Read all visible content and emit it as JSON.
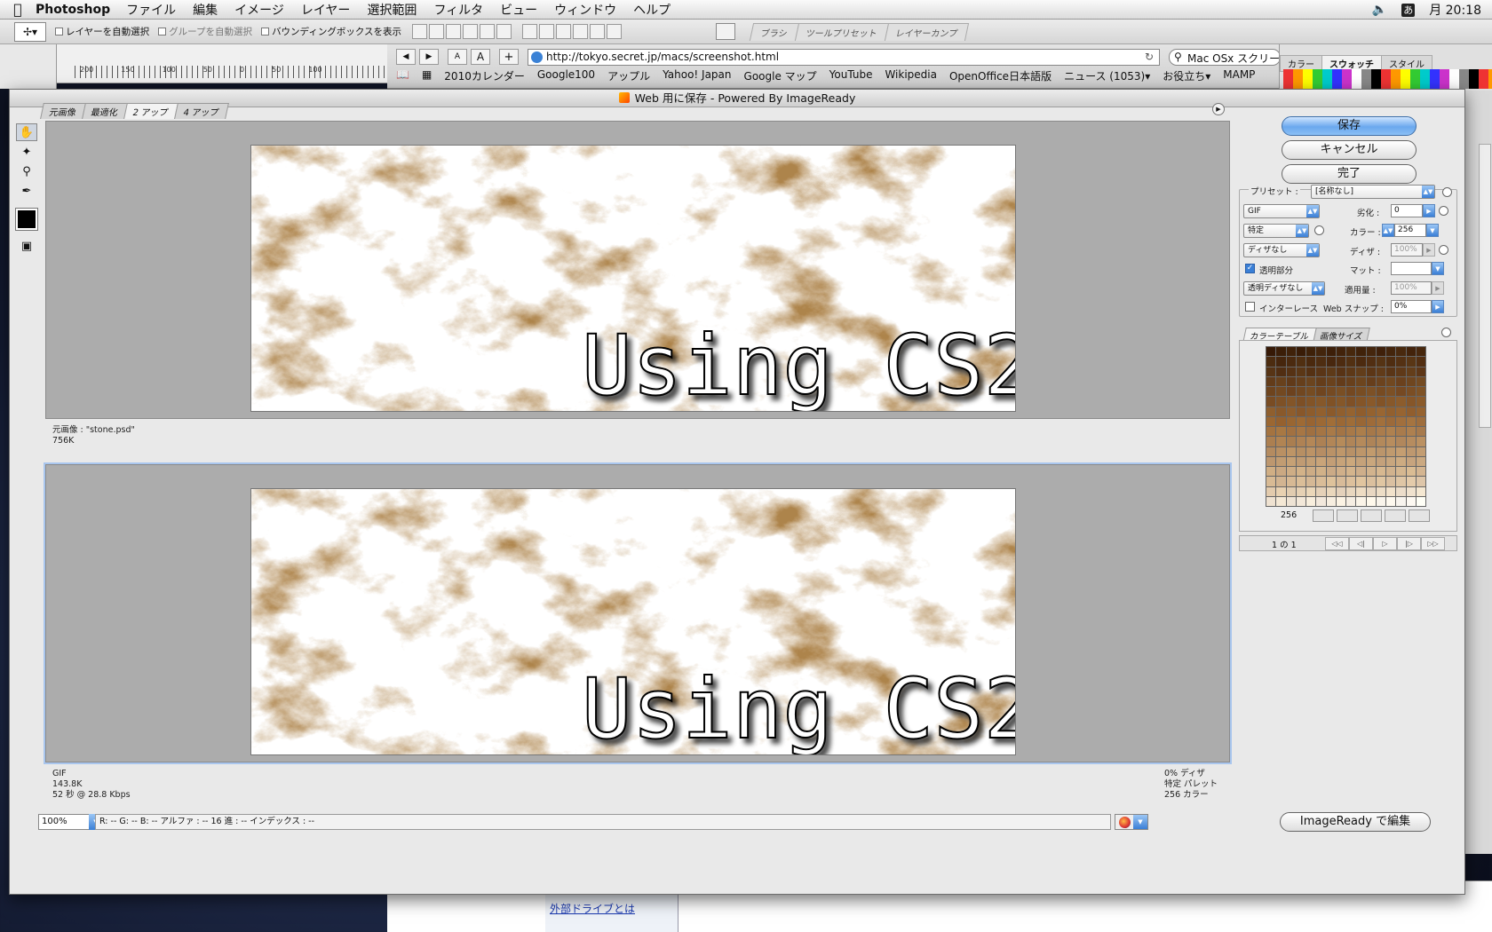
{
  "menubar": {
    "app": "Photoshop",
    "items": [
      "ファイル",
      "編集",
      "イメージ",
      "レイヤー",
      "選択範囲",
      "フィルタ",
      "ビュー",
      "ウィンドウ",
      "ヘルプ"
    ],
    "ime": "あ",
    "clock": "月 20:18"
  },
  "options": {
    "auto_select_layer": "レイヤーを自動選択",
    "auto_select_group": "グループを自動選択",
    "show_bbox": "バウンディングボックスを表示",
    "wells": [
      "ブラシ",
      "ツールプリセット",
      "レイヤーカンプ"
    ]
  },
  "ruler": {
    "labels": [
      "200",
      "150",
      "100",
      "50",
      "0",
      "50",
      "100"
    ]
  },
  "browser": {
    "url": "http://tokyo.secret.jp/macs/screenshot.html",
    "search": "Mac OSx スクリー",
    "bookmarks": [
      "2010カレンダー",
      "Google100",
      "アップル",
      "Yahoo! Japan",
      "Google マップ",
      "YouTube",
      "Wikipedia",
      "OpenOffice日本語版",
      "ニュース (1053)▾",
      "お役立ち▾",
      "MAMP"
    ]
  },
  "right_panels": {
    "tabs": [
      "カラー",
      "スウォッチ",
      "スタイル"
    ],
    "active_tab": "スウォッチ"
  },
  "dialog": {
    "title": "Web 用に保存 - Powered By ImageReady",
    "view_tabs": [
      "元画像",
      "最適化",
      "2 アップ",
      "4 アップ"
    ],
    "active_view_tab": "2 アップ",
    "image_text": "Using CS2",
    "original": {
      "name": "元画像 : \"stone.psd\"",
      "size": "756K"
    },
    "optimized": {
      "format": "GIF",
      "size": "143.8K",
      "time": "52 秒 @ 28.8 Kbps",
      "dither": "0% ディザ",
      "palette": "特定 パレット",
      "colors": "256 カラー"
    }
  },
  "buttons": {
    "save": "保存",
    "cancel": "キャンセル",
    "done": "完了",
    "edit_imageready": "ImageReady で編集"
  },
  "settings": {
    "preset_label": "プリセット :",
    "preset_value": "[名称なし]",
    "format": "GIF",
    "reduction": "特定",
    "dither_algo": "ディザなし",
    "transparency_label": "透明部分",
    "transparency_checked": true,
    "trans_dither": "透明ディザなし",
    "interlace_label": "インターレース",
    "interlace_checked": false,
    "lossy_label": "劣化 :",
    "lossy_value": "0",
    "colors_label": "カラー :",
    "colors_value": "256",
    "dither_label": "ディザ :",
    "dither_value": "100%",
    "matte_label": "マット :",
    "matte_value": "",
    "amount_label": "適用量 :",
    "amount_value": "100%",
    "websnap_label": "Web スナップ :",
    "websnap_value": "0%"
  },
  "color_table": {
    "tabs": [
      "カラーテーブル",
      "画像サイズ"
    ],
    "active_tab": "カラーテーブル",
    "count": "256",
    "page": "1 の 1",
    "nav": [
      "◁◁",
      "◁|",
      "▷",
      "|▷",
      "▷▷"
    ]
  },
  "status": {
    "zoom": "100%",
    "readout": "R:  --   G:  --  B:   -- アルファ :   --   16 進 :             --     インデックス :                 --"
  },
  "colors": {
    "accent": "#3a7fd6",
    "sepia_dark": "#3b1e08",
    "sepia_mid": "#9a6632",
    "sepia_light": "#dcc09c"
  },
  "bottom_page": {
    "link": "外部ドライブとは"
  }
}
